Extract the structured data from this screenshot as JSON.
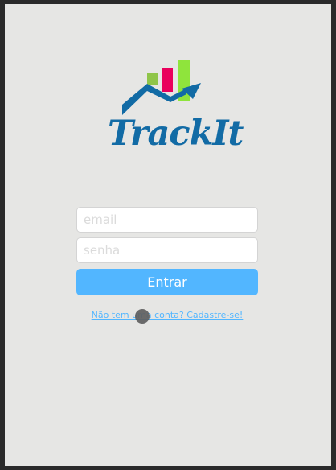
{
  "logo": {
    "icon": "chart-house-logo-icon",
    "text": "TrackIt",
    "colors": {
      "bar_left": "#8fc549",
      "bar_middle": "#e9005c",
      "bar_right": "#8fe43c",
      "arrow": "#126ba5"
    }
  },
  "form": {
    "email_placeholder": "email",
    "password_placeholder": "senha",
    "submit_label": "Entrar"
  },
  "signup_link": "Não tem uma conta? Cadastre-se!",
  "colors": {
    "background": "#e6e6e4",
    "accent": "#52b6ff",
    "brand": "#126ba5"
  }
}
